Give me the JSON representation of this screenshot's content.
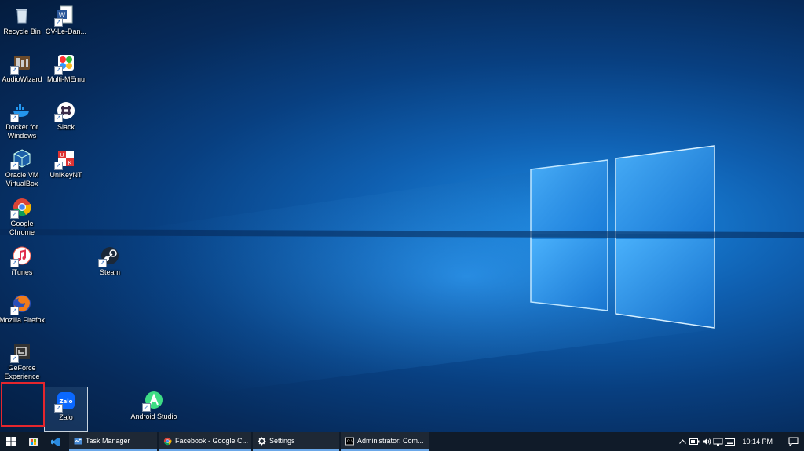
{
  "desktop": {
    "icons": [
      {
        "label": "Recycle Bin",
        "icon": "recycle-bin-icon"
      },
      {
        "label": "CV-Le-Dan...",
        "icon": "word-document-icon"
      },
      {
        "label": "AudioWizard",
        "icon": "audiowizard-icon"
      },
      {
        "label": "Multi-MEmu",
        "icon": "multi-memu-icon"
      },
      {
        "label": "Docker for Windows",
        "icon": "docker-icon"
      },
      {
        "label": "Slack",
        "icon": "slack-icon"
      },
      {
        "label": "Oracle VM VirtualBox",
        "icon": "virtualbox-icon"
      },
      {
        "label": "UniKeyNT",
        "icon": "unikey-icon"
      },
      {
        "label": "Google Chrome",
        "icon": "chrome-icon"
      },
      {
        "label": "iTunes",
        "icon": "itunes-icon"
      },
      {
        "label": "Steam",
        "icon": "steam-icon"
      },
      {
        "label": "Mozilla Firefox",
        "icon": "firefox-icon"
      },
      {
        "label": "GeForce Experience",
        "icon": "geforce-icon"
      },
      {
        "label": "Zalo",
        "icon": "zalo-icon"
      },
      {
        "label": "Android Studio",
        "icon": "android-studio-icon"
      }
    ]
  },
  "taskbar": {
    "apps": [
      {
        "label": "Task Manager",
        "icon": "task-manager-icon"
      },
      {
        "label": "Facebook - Google C...",
        "icon": "chrome-icon"
      },
      {
        "label": "Settings",
        "icon": "gear-icon"
      },
      {
        "label": "Administrator: Com...",
        "icon": "command-prompt-icon"
      }
    ],
    "clock": "10:14 PM",
    "colors": {
      "taskbar_bg": "#101b29",
      "active_underline": "#6aa7e8"
    }
  }
}
